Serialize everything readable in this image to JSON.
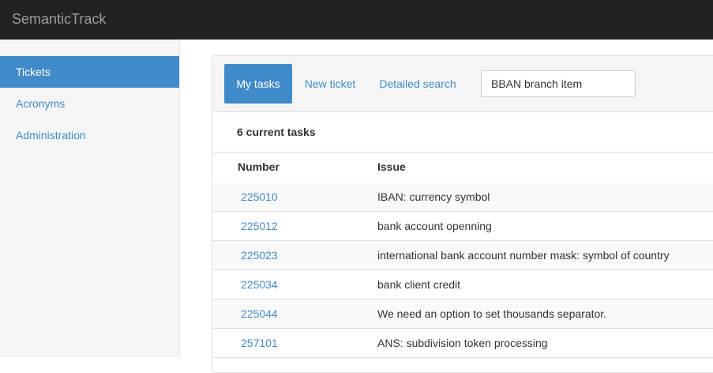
{
  "app": {
    "brand": "SemanticTrack"
  },
  "sidebar": {
    "items": [
      {
        "label": "Tickets"
      },
      {
        "label": "Acronyms"
      },
      {
        "label": "Administration"
      }
    ]
  },
  "tabs": {
    "my_tasks": "My tasks",
    "new_ticket": "New ticket",
    "detailed_search": "Detailed search"
  },
  "search": {
    "value": "BBAN branch item"
  },
  "summary": {
    "count_text": "6 current tasks"
  },
  "table": {
    "headers": {
      "number": "Number",
      "issue": "Issue"
    },
    "rows": [
      {
        "number": "225010",
        "issue": "IBAN: currency symbol"
      },
      {
        "number": "225012",
        "issue": "bank account openning"
      },
      {
        "number": "225023",
        "issue": "international bank account number mask: symbol of country"
      },
      {
        "number": "225034",
        "issue": "bank client credit"
      },
      {
        "number": "225044",
        "issue": "We need an option to set thousands separator."
      },
      {
        "number": "257101",
        "issue": "ANS: subdivision token processing"
      }
    ]
  },
  "colors": {
    "navbar": "#222222",
    "accent": "#428bca",
    "sidebar_bg": "#f5f5f5"
  }
}
